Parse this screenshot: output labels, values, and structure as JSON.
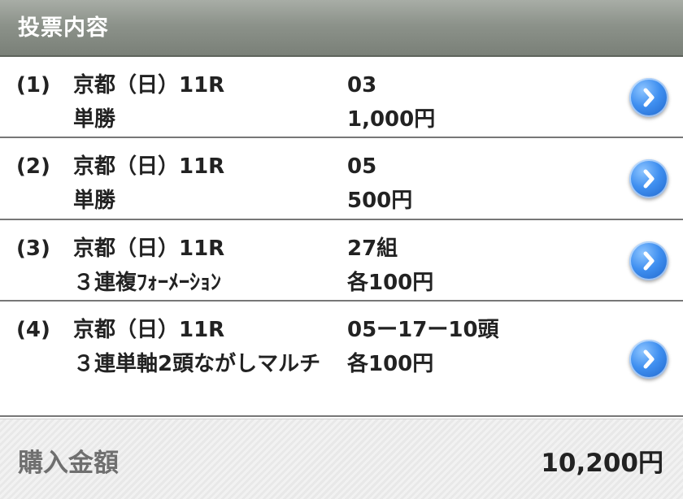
{
  "header": {
    "title": "投票内容"
  },
  "bets": [
    {
      "index": "(1)",
      "race": "京都（日）11R",
      "type": "単勝",
      "selection": "03",
      "amount": "1,000円",
      "icon": "chevron-right-icon"
    },
    {
      "index": "(2)",
      "race": "京都（日）11R",
      "type": "単勝",
      "selection": "05",
      "amount": "500円",
      "icon": "chevron-right-icon"
    },
    {
      "index": "(3)",
      "race": "京都（日）11R",
      "type": "３連複ﾌｫｰﾒｰｼｮﾝ",
      "selection": "27組",
      "amount": "各100円",
      "icon": "chevron-right-icon"
    },
    {
      "index": "(4)",
      "race": "京都（日）11R",
      "type": "３連単軸2頭ながしマルチ",
      "selection": "05ー17ー10頭",
      "amount": "各100円",
      "icon": "chevron-right-icon"
    }
  ],
  "total": {
    "label": "購入金額",
    "value": "10,200円"
  },
  "colors": {
    "header_bg": "#8c928a",
    "arrow_blue": "#3f8ff0",
    "divider": "#777777"
  }
}
